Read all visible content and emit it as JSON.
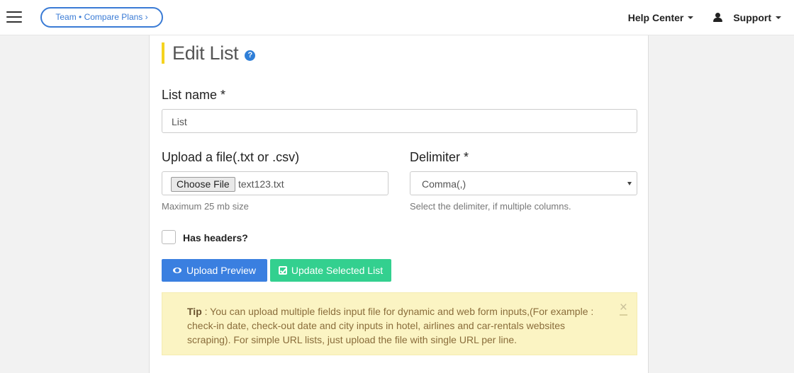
{
  "header": {
    "team_pill": "Team • Compare Plans ›",
    "help_center": "Help Center",
    "support": "Support"
  },
  "page": {
    "title": "Edit List",
    "help_glyph": "?"
  },
  "form": {
    "list_name_label": "List name *",
    "list_name_value": "List",
    "upload_label": "Upload a file(.txt or .csv)",
    "choose_file": "Choose File",
    "file_name": "text123.txt",
    "upload_help": "Maximum 25 mb size",
    "delimiter_label": "Delimiter *",
    "delimiter_value": "Comma(,)",
    "delimiter_help": "Select the delimiter, if multiple columns.",
    "has_headers_label": "Has headers?",
    "has_headers_checked": false
  },
  "buttons": {
    "upload_preview": "Upload Preview",
    "update_selected": "Update Selected List"
  },
  "tip": {
    "title": "Tip",
    "text": " : You can upload multiple fields input file for dynamic and web form inputs,(For example : check-in date, check-out date and city inputs in hotel, airlines and car-rentals websites scraping). For simple URL lists, just upload the file with single URL per line.",
    "close": "×"
  },
  "colors": {
    "accent_blue": "#3a7fe0",
    "accent_green": "#33d08f",
    "title_bar": "#f5d31f",
    "tip_bg": "#fbf4c3"
  }
}
